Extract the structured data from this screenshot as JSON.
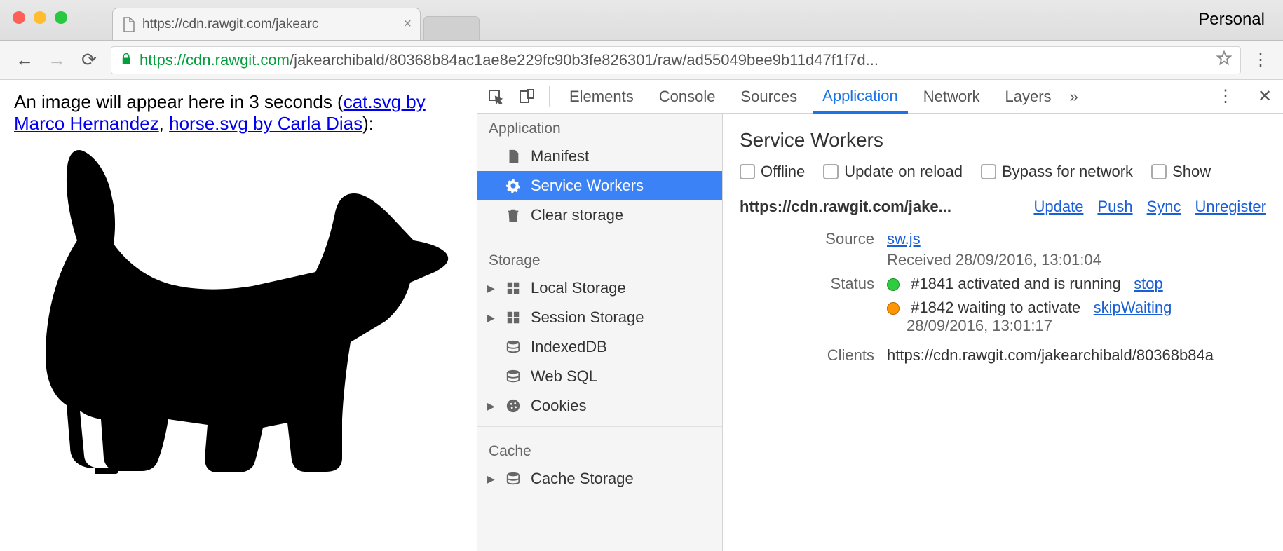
{
  "chrome": {
    "tab_title": "https://cdn.rawgit.com/jakearc",
    "profile": "Personal",
    "url_secure": "https",
    "url_host": "://cdn.rawgit.com",
    "url_path": "/jakearchibald/80368b84ac1ae8e229fc90b3fe826301/raw/ad55049bee9b11d47f1f7d..."
  },
  "page": {
    "pre_text": "An image will appear here in 3 seconds (",
    "link1": "cat.svg by Marco Hernandez",
    "mid_text": ", ",
    "link2": "horse.svg by Carla Dias",
    "post_text": "):"
  },
  "devtools": {
    "tabs": [
      "Elements",
      "Console",
      "Sources",
      "Application",
      "Network",
      "Layers"
    ],
    "active_tab": "Application",
    "overflow": "»",
    "sidebar": {
      "groups": [
        {
          "title": "Application",
          "items": [
            {
              "label": "Manifest",
              "icon": "doc"
            },
            {
              "label": "Service Workers",
              "icon": "gear",
              "active": true
            },
            {
              "label": "Clear storage",
              "icon": "trash"
            }
          ]
        },
        {
          "title": "Storage",
          "items": [
            {
              "label": "Local Storage",
              "icon": "grid",
              "arrow": true
            },
            {
              "label": "Session Storage",
              "icon": "grid",
              "arrow": true
            },
            {
              "label": "IndexedDB",
              "icon": "db"
            },
            {
              "label": "Web SQL",
              "icon": "db"
            },
            {
              "label": "Cookies",
              "icon": "cookie",
              "arrow": true
            }
          ]
        },
        {
          "title": "Cache",
          "items": [
            {
              "label": "Cache Storage",
              "icon": "db",
              "arrow": true
            }
          ]
        }
      ]
    },
    "panel": {
      "title": "Service Workers",
      "checks": [
        "Offline",
        "Update on reload",
        "Bypass for network",
        "Show"
      ],
      "origin": "https://cdn.rawgit.com/jake...",
      "actions": [
        "Update",
        "Push",
        "Sync",
        "Unregister"
      ],
      "source_label": "Source",
      "source_link": "sw.js",
      "source_received": "Received 28/09/2016, 13:01:04",
      "status_label": "Status",
      "status_1_text": "#1841 activated and is running",
      "status_1_action": "stop",
      "status_2_text": "#1842 waiting to activate",
      "status_2_action": "skipWaiting",
      "status_2_time": "28/09/2016, 13:01:17",
      "clients_label": "Clients",
      "clients_value": "https://cdn.rawgit.com/jakearchibald/80368b84a"
    }
  }
}
